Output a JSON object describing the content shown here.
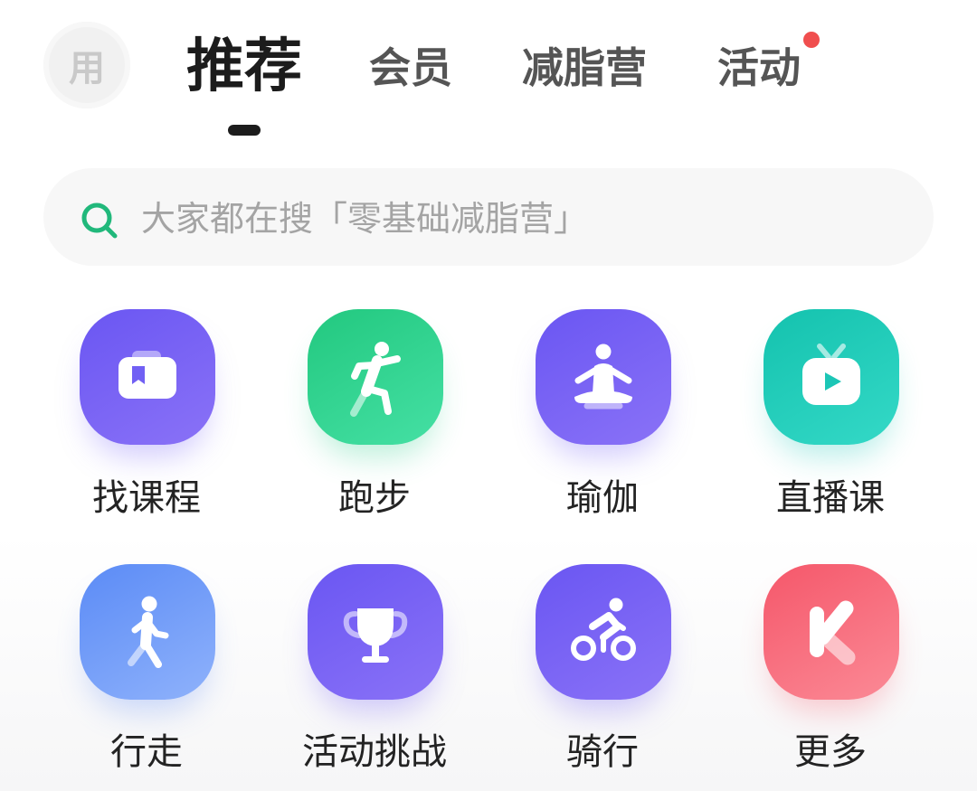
{
  "header": {
    "avatar_text": "用",
    "tabs": [
      {
        "label": "推荐",
        "active": true
      },
      {
        "label": "会员",
        "active": false
      },
      {
        "label": "减脂营",
        "active": false
      },
      {
        "label": "活动",
        "active": false,
        "has_red_dot": true
      }
    ]
  },
  "search": {
    "placeholder": "大家都在搜「零基础减脂营」",
    "icon": "search-icon"
  },
  "categories": [
    {
      "label": "找课程",
      "icon": "course-card-icon",
      "color": "#6a56f2"
    },
    {
      "label": "跑步",
      "icon": "running-icon",
      "color": "#22c87f"
    },
    {
      "label": "瑜伽",
      "icon": "yoga-icon",
      "color": "#6a56f2"
    },
    {
      "label": "直播课",
      "icon": "live-tv-icon",
      "color": "#14c2ae"
    },
    {
      "label": "行走",
      "icon": "walking-icon",
      "color": "#5b8bf6"
    },
    {
      "label": "活动挑战",
      "icon": "trophy-icon",
      "color": "#6a56f2"
    },
    {
      "label": "骑行",
      "icon": "cycling-icon",
      "color": "#6a56f2"
    },
    {
      "label": "更多",
      "icon": "keep-logo-icon",
      "color": "#f5576a"
    }
  ],
  "colors": {
    "accent_green": "#21b87b",
    "notification_dot": "#f04e4e",
    "text_primary": "#1c1c1c",
    "text_secondary": "#555555",
    "placeholder": "#a4a4a4"
  }
}
